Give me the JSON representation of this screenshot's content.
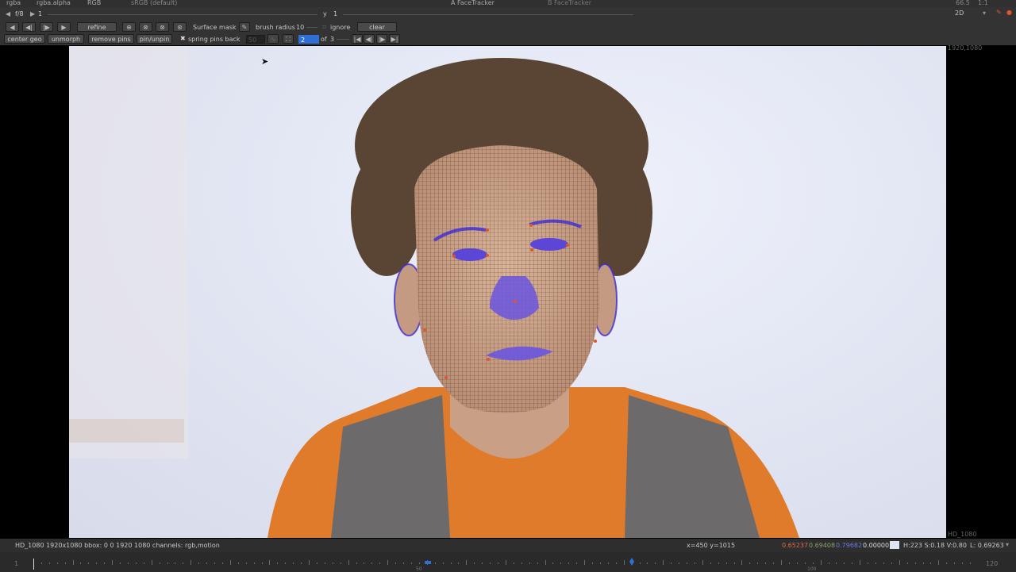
{
  "top_strip": {
    "channel_a": "rgba",
    "channel_b": "rgba.alpha",
    "display": "RGB",
    "colorspace": "sRGB (default)",
    "input_a": "A  FaceTracker",
    "input_b": "B  FaceTracker",
    "zoom": "66.5",
    "proxy": "1:1"
  },
  "frame_row": {
    "fstop": "f/8",
    "frame_value": "1",
    "y_label": "y",
    "y_value": "1",
    "view_mode": "2D"
  },
  "toolbar": {
    "refine": "refine",
    "surface_mask": "Surface mask",
    "brush_radius_label": "brush radius",
    "brush_radius_value": "10",
    "ignore": "ignore",
    "clear": "clear",
    "center_geo": "center geo",
    "unmorph": "unmorph",
    "remove_pins": "remove pins",
    "pin_unpin": "pin/unpin",
    "spring_pins_back": "spring pins back",
    "spring_value": "50",
    "current_index": "2",
    "of_label": "of",
    "total": "3"
  },
  "viewer": {
    "format_top_right": "1920,1080",
    "format_bottom_right": "HD_1080"
  },
  "status": {
    "format_info": "HD_1080 1920x1080  bbox: 0 0 1920 1080 channels: rgb,motion",
    "coords": "x=450 y=1015",
    "r": "0.65237",
    "g": "0.69408",
    "b": "0.79682",
    "a": "0.00000",
    "hsv": "H:223 S:0.18 V:0.80",
    "luma": "L: 0.69263"
  },
  "timeline": {
    "start": "1",
    "ticks": [
      "50",
      "100"
    ],
    "end": "120",
    "playhead_frame": "1",
    "key_marker_frames": [
      50,
      80
    ]
  },
  "colors": {
    "accent_blue": "#2f6fd6",
    "mesh_color": "#5a3a1a",
    "feature_mesh": "#3b2bd8",
    "pin_color": "#e0562a"
  }
}
